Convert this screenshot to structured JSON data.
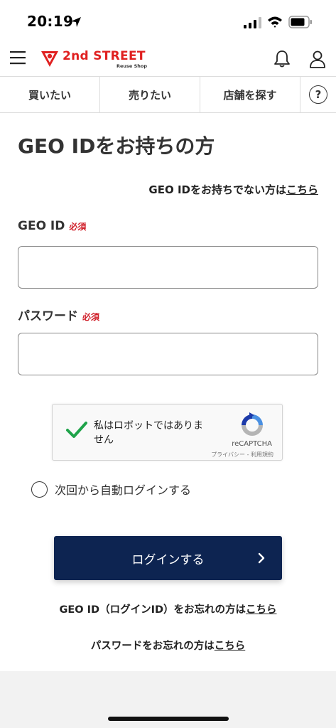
{
  "status_bar": {
    "time": "20:19"
  },
  "header": {
    "logo_text": "2nd STREET",
    "logo_sub": "Reuse Shop"
  },
  "nav": {
    "tabs": [
      {
        "label": "買いたい"
      },
      {
        "label": "売りたい"
      },
      {
        "label": "店舗を探す"
      }
    ],
    "help_label": "?"
  },
  "page": {
    "title": "GEO IDをお持ちの方",
    "no_id_text": "GEO IDをお持ちでない方は",
    "no_id_link": "こちら"
  },
  "form": {
    "geo_id_label": "GEO ID",
    "password_label": "パスワード",
    "required_badge": "必須",
    "geo_id_value": "",
    "password_value": ""
  },
  "captcha": {
    "text": "私はロボットではありません",
    "brand": "reCAPTCHA",
    "terms": "プライバシー - 利用規約"
  },
  "remember": {
    "label": "次回から自動ログインする"
  },
  "login_button": {
    "label": "ログインする"
  },
  "forgot": {
    "id_text": "GEO ID（ログインID）をお忘れの方は",
    "id_link": "こちら",
    "pw_text": "パスワードをお忘れの方は",
    "pw_link": "こちら"
  },
  "colors": {
    "accent_red": "#e02020",
    "button_navy": "#0d2451",
    "required_red": "#d0202a",
    "check_green": "#1fa34a"
  }
}
